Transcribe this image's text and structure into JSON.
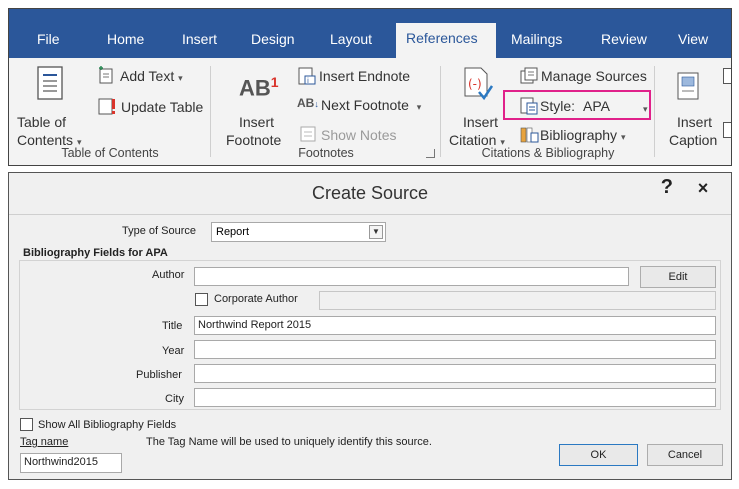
{
  "ribbon": {
    "tabs": [
      {
        "label": "File"
      },
      {
        "label": "Home"
      },
      {
        "label": "Insert"
      },
      {
        "label": "Design"
      },
      {
        "label": "Layout"
      },
      {
        "label": "References"
      },
      {
        "label": "Mailings"
      },
      {
        "label": "Review"
      },
      {
        "label": "View"
      }
    ],
    "active_tab": "References",
    "toc_group": {
      "name": "Table of Contents",
      "toc_button_line1": "Table of",
      "toc_button_line2": "Contents",
      "add_text": "Add Text",
      "update_table": "Update Table"
    },
    "footnotes_group": {
      "name": "Footnotes",
      "ab_glyph": "AB",
      "ab_superscript": "1",
      "insert_footnote_line1": "Insert",
      "insert_footnote_line2": "Footnote",
      "insert_endnote": "Insert Endnote",
      "next_footnote": "Next Footnote",
      "show_notes": "Show Notes"
    },
    "citations_group": {
      "name": "Citations & Bibliography",
      "insert_citation_line1": "Insert",
      "insert_citation_line2": "Citation",
      "manage_sources": "Manage Sources",
      "style_label": "Style:",
      "style_value": "APA",
      "bibliography": "Bibliography"
    },
    "captions_group": {
      "insert_caption_line1": "Insert",
      "insert_caption_line2": "Caption"
    },
    "colors": {
      "tabbar": "#2b579a",
      "highlight": "#e0218a"
    }
  },
  "dialog": {
    "title": "Create Source",
    "help": "?",
    "close": "×",
    "type_of_source_label": "Type of Source",
    "type_of_source_value": "Report",
    "bibliography_fields_label": "Bibliography Fields for APA",
    "fields": {
      "author": {
        "label": "Author",
        "value": ""
      },
      "corporate_author": {
        "label": "Corporate Author",
        "value": ""
      },
      "title": {
        "label": "Title",
        "value": "Northwind Report 2015"
      },
      "year": {
        "label": "Year",
        "value": ""
      },
      "publisher": {
        "label": "Publisher",
        "value": ""
      },
      "city": {
        "label": "City",
        "value": ""
      }
    },
    "edit_button": "Edit",
    "show_all_fields": "Show All Bibliography Fields",
    "tag_name_label": "Tag name",
    "tag_name_value": "Northwind2015",
    "tag_hint": "The Tag Name will be used to uniquely identify this source.",
    "ok_button": "OK",
    "cancel_button": "Cancel"
  }
}
